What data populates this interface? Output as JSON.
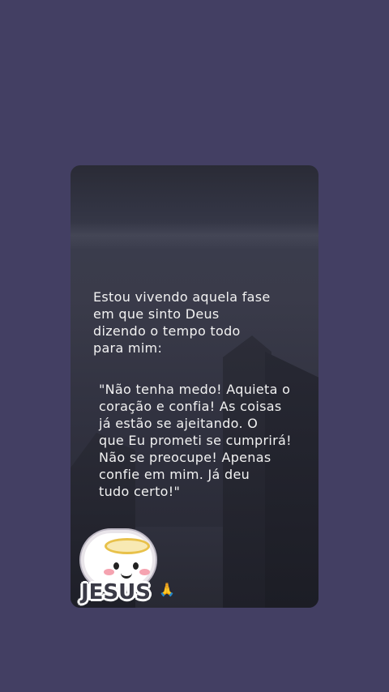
{
  "card": {
    "intro_lines": [
      "Estou vivendo aquela fase",
      "em que sinto Deus",
      "dizendo o tempo todo",
      "para mim:"
    ],
    "quote_lines": [
      "\"Não tenha medo! Aquieta o",
      "coração e confia! As coisas",
      "já estão se ajeitando. O",
      "que Eu prometi se cumprirá!",
      "Não se preocupe! Apenas",
      "confie em mim. Já deu",
      "tudo certo!\""
    ]
  },
  "sticker": {
    "text": "JESUS",
    "emoji": "🙏"
  }
}
